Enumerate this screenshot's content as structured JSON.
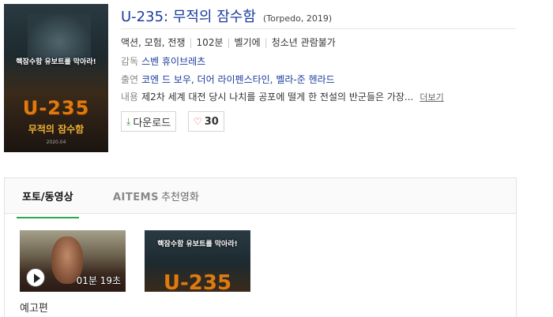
{
  "poster": {
    "tagline": "핵잠수함 유보트를 막아라!",
    "big_title": "U-235",
    "small_title": "무적의 잠수함",
    "date": "2020.04"
  },
  "movie": {
    "title": "U-235: 무적의 잠수함",
    "original": "(Torpedo, 2019)",
    "genres": "액션, 모험, 전쟁",
    "runtime": "102분",
    "country": "벨기에",
    "rating": "청소년 관람불가",
    "director_label": "감독",
    "director": "스벤 휴이브레츠",
    "cast_label": "출연",
    "cast": "코엔 드 보우, 더어 라이펜스타인, 벨라-준 헨라드",
    "plot_label": "내용",
    "plot": "제2차 세계 대전 당시 나치를 공포에 떨게 한 전설의 반군들은 가장...",
    "more_label": "더보기"
  },
  "actions": {
    "download_label": "다운로드",
    "download_icon": "download-arrow-icon",
    "like_icon": "heart-icon",
    "like_count": "30"
  },
  "tabs": {
    "photo_video": "포토/동영상",
    "aitems_brand": "AITEMS",
    "aitems_label": "추천영화"
  },
  "media": {
    "trailer_duration": "01분 19초",
    "trailer_caption": "예고편",
    "poster_tagline": "핵잠수함 유보트를 막아라!",
    "poster_big": "U-235"
  },
  "colors": {
    "title_blue": "#1a3c9c",
    "active_tab_green": "#2aa84a",
    "poster_orange": "#e07a10"
  }
}
